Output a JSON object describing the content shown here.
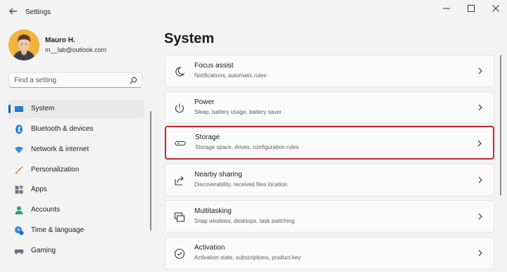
{
  "window": {
    "title": "Settings",
    "back_icon": "back-arrow-icon",
    "controls": [
      "minimize-icon",
      "maximize-icon",
      "close-icon"
    ]
  },
  "user": {
    "name": "Mauro H.",
    "email": "m__lab@outlook.com"
  },
  "search": {
    "placeholder": "Find a setting"
  },
  "sidebar": {
    "items": [
      {
        "label": "System",
        "icon": "system-icon",
        "active": true
      },
      {
        "label": "Bluetooth & devices",
        "icon": "bluetooth-icon"
      },
      {
        "label": "Network & internet",
        "icon": "network-icon"
      },
      {
        "label": "Personalization",
        "icon": "personalization-icon"
      },
      {
        "label": "Apps",
        "icon": "apps-icon"
      },
      {
        "label": "Accounts",
        "icon": "accounts-icon"
      },
      {
        "label": "Time & language",
        "icon": "time-language-icon"
      },
      {
        "label": "Gaming",
        "icon": "gaming-icon"
      }
    ]
  },
  "main": {
    "title": "System",
    "cards": [
      {
        "title": "Focus assist",
        "subtitle": "Notifications, automatic rules",
        "icon": "focus-assist-icon"
      },
      {
        "title": "Power",
        "subtitle": "Sleep, battery usage, battery saver",
        "icon": "power-icon"
      },
      {
        "title": "Storage",
        "subtitle": "Storage space, drives, configuration rules",
        "icon": "storage-icon",
        "highlighted": true
      },
      {
        "title": "Nearby sharing",
        "subtitle": "Discoverability, received files location",
        "icon": "nearby-sharing-icon"
      },
      {
        "title": "Multitasking",
        "subtitle": "Snap windows, desktops, task switching",
        "icon": "multitasking-icon"
      },
      {
        "title": "Activation",
        "subtitle": "Activation state, subscriptions, product key",
        "icon": "activation-icon"
      }
    ]
  },
  "colors": {
    "accent": "#005fb8",
    "highlight_border": "#c8262f",
    "avatar_bg": "#f1b33a"
  }
}
